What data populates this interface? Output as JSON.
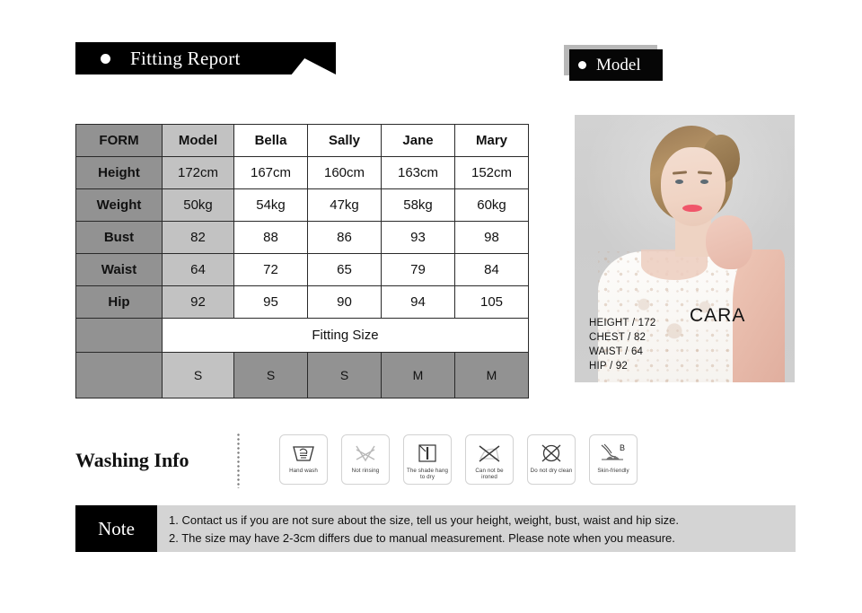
{
  "banners": {
    "fitting_report": "Fitting Report",
    "model": "Model"
  },
  "size_table": {
    "columns": [
      "FORM",
      "Model",
      "Bella",
      "Sally",
      "Jane",
      "Mary"
    ],
    "rows": [
      {
        "label": "Height",
        "values": [
          "172cm",
          "167cm",
          "160cm",
          "163cm",
          "152cm"
        ]
      },
      {
        "label": "Weight",
        "values": [
          "50kg",
          "54kg",
          "47kg",
          "58kg",
          "60kg"
        ]
      },
      {
        "label": "Bust",
        "values": [
          "82",
          "88",
          "86",
          "93",
          "98"
        ]
      },
      {
        "label": "Waist",
        "values": [
          "64",
          "72",
          "65",
          "79",
          "84"
        ]
      },
      {
        "label": "Hip",
        "values": [
          "92",
          "95",
          "90",
          "94",
          "105"
        ]
      }
    ],
    "fitting_size_title": "Fitting Size",
    "fitting_sizes": [
      "S",
      "S",
      "S",
      "M",
      "M"
    ],
    "colors": {
      "label_bg": "#929292",
      "model_bg": "#c2c2c2",
      "border": "#2a2a2a"
    }
  },
  "model_card": {
    "name": "CARA",
    "stats": [
      "HEIGHT /  172",
      "CHEST /  82",
      "WAIST /  64",
      "HIP /  92"
    ]
  },
  "washing": {
    "title": "Washing Info",
    "icons": [
      {
        "icon": "hand-wash-icon",
        "caption": "Hand wash"
      },
      {
        "icon": "not-rinsing-icon",
        "caption": "Not rinsing"
      },
      {
        "icon": "shade-hang-dry-icon",
        "caption": "The shade hang to dry"
      },
      {
        "icon": "no-iron-icon",
        "caption": "Can not be ironed"
      },
      {
        "icon": "no-dry-clean-icon",
        "caption": "Do not dry clean"
      },
      {
        "icon": "skin-friendly-icon",
        "caption": "Skin-friendly"
      }
    ]
  },
  "note": {
    "tag": "Note",
    "line1": "1. Contact us if you are not sure about the size, tell us your height, weight, bust, waist and hip size.",
    "line2": "2. The size may have 2-3cm differs due to manual measurement. Please note when you measure."
  }
}
